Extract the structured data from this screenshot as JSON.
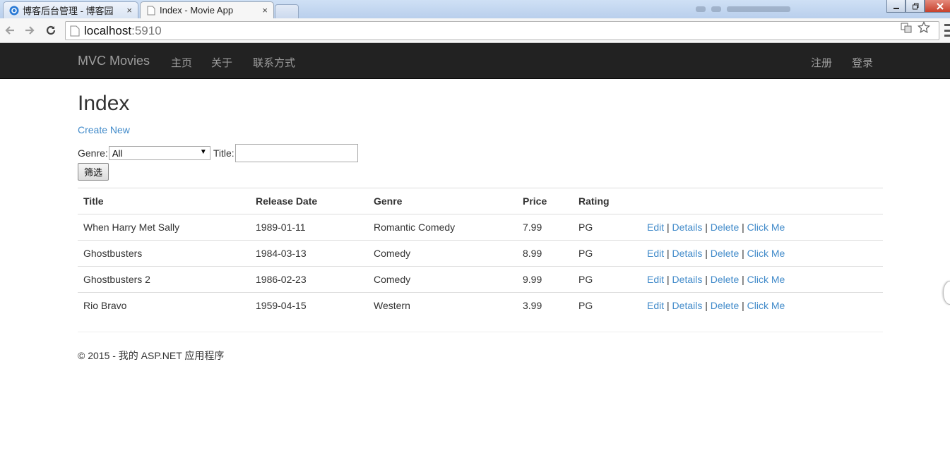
{
  "browser": {
    "tabs": [
      {
        "title": "博客后台管理 - 博客园",
        "active": false,
        "icon": "cnblogs-icon"
      },
      {
        "title": "Index - Movie App",
        "active": true,
        "icon": "page-icon"
      }
    ],
    "close_glyph": "×",
    "address": {
      "host": "localhost",
      "port": ":5910"
    }
  },
  "navbar": {
    "brand": "MVC Movies",
    "left_links": [
      "主页",
      "关于",
      "联系方式"
    ],
    "right_links": [
      "注册",
      "登录"
    ]
  },
  "page": {
    "title": "Index",
    "create_new": "Create New"
  },
  "filter": {
    "genre_label": "Genre:",
    "genre_selected": "All",
    "title_label": "Title:",
    "title_value": "",
    "submit_label": "筛选"
  },
  "table": {
    "headers": [
      "Title",
      "Release Date",
      "Genre",
      "Price",
      "Rating",
      ""
    ],
    "rows": [
      {
        "title": "When Harry Met Sally",
        "release_date": "1989-01-11",
        "genre": "Romantic Comedy",
        "price": "7.99",
        "rating": "PG"
      },
      {
        "title": "Ghostbusters",
        "release_date": "1984-03-13",
        "genre": "Comedy",
        "price": "8.99",
        "rating": "PG"
      },
      {
        "title": "Ghostbusters 2",
        "release_date": "1986-02-23",
        "genre": "Comedy",
        "price": "9.99",
        "rating": "PG"
      },
      {
        "title": "Rio Bravo",
        "release_date": "1959-04-15",
        "genre": "Western",
        "price": "3.99",
        "rating": "PG"
      }
    ],
    "actions": {
      "edit": "Edit",
      "details": "Details",
      "delete": "Delete",
      "click_me": "Click Me",
      "separator": "|"
    }
  },
  "footer": {
    "text": "© 2015 - 我的 ASP.NET 应用程序"
  },
  "colors": {
    "navbar_bg": "#222222",
    "navbar_link": "#9d9d9d",
    "link": "#428bca",
    "text": "#333333"
  }
}
